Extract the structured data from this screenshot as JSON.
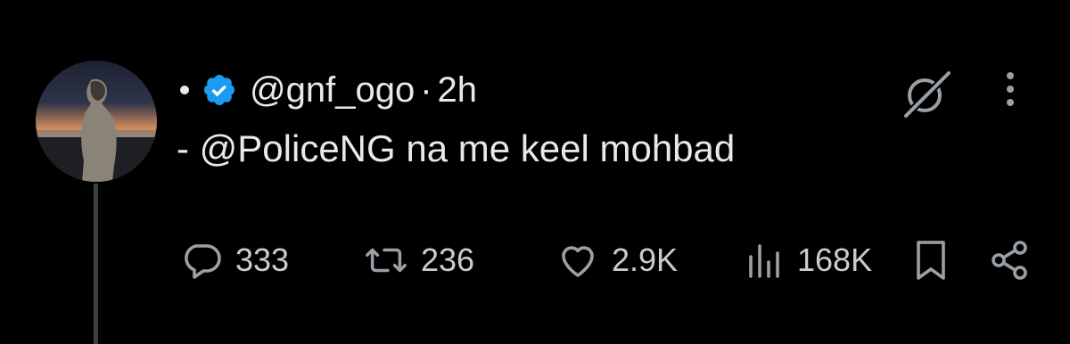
{
  "tweet": {
    "bullet": "•",
    "handle": "@gnf_ogo",
    "separator": "·",
    "time": "2h",
    "text": "- @PoliceNG na me keel mohbad",
    "verified": true
  },
  "actions": {
    "replies": "333",
    "retweets": "236",
    "likes": "2.9K",
    "views": "168K"
  },
  "icons": {
    "reply": "speech-bubble-icon",
    "retweet": "retweet-icon",
    "like": "heart-icon",
    "views": "bar-chart-icon",
    "bookmark": "bookmark-icon",
    "share": "share-icon",
    "grok": "grok-icon",
    "more": "more-vertical-icon",
    "verified": "verified-badge-icon"
  },
  "colors": {
    "background": "#000000",
    "text": "#e7e9ea",
    "muted": "#c9cdd1",
    "icon": "#9aa0a6",
    "verified_blue": "#1d9bf0",
    "thread_line": "#3a3f44"
  }
}
